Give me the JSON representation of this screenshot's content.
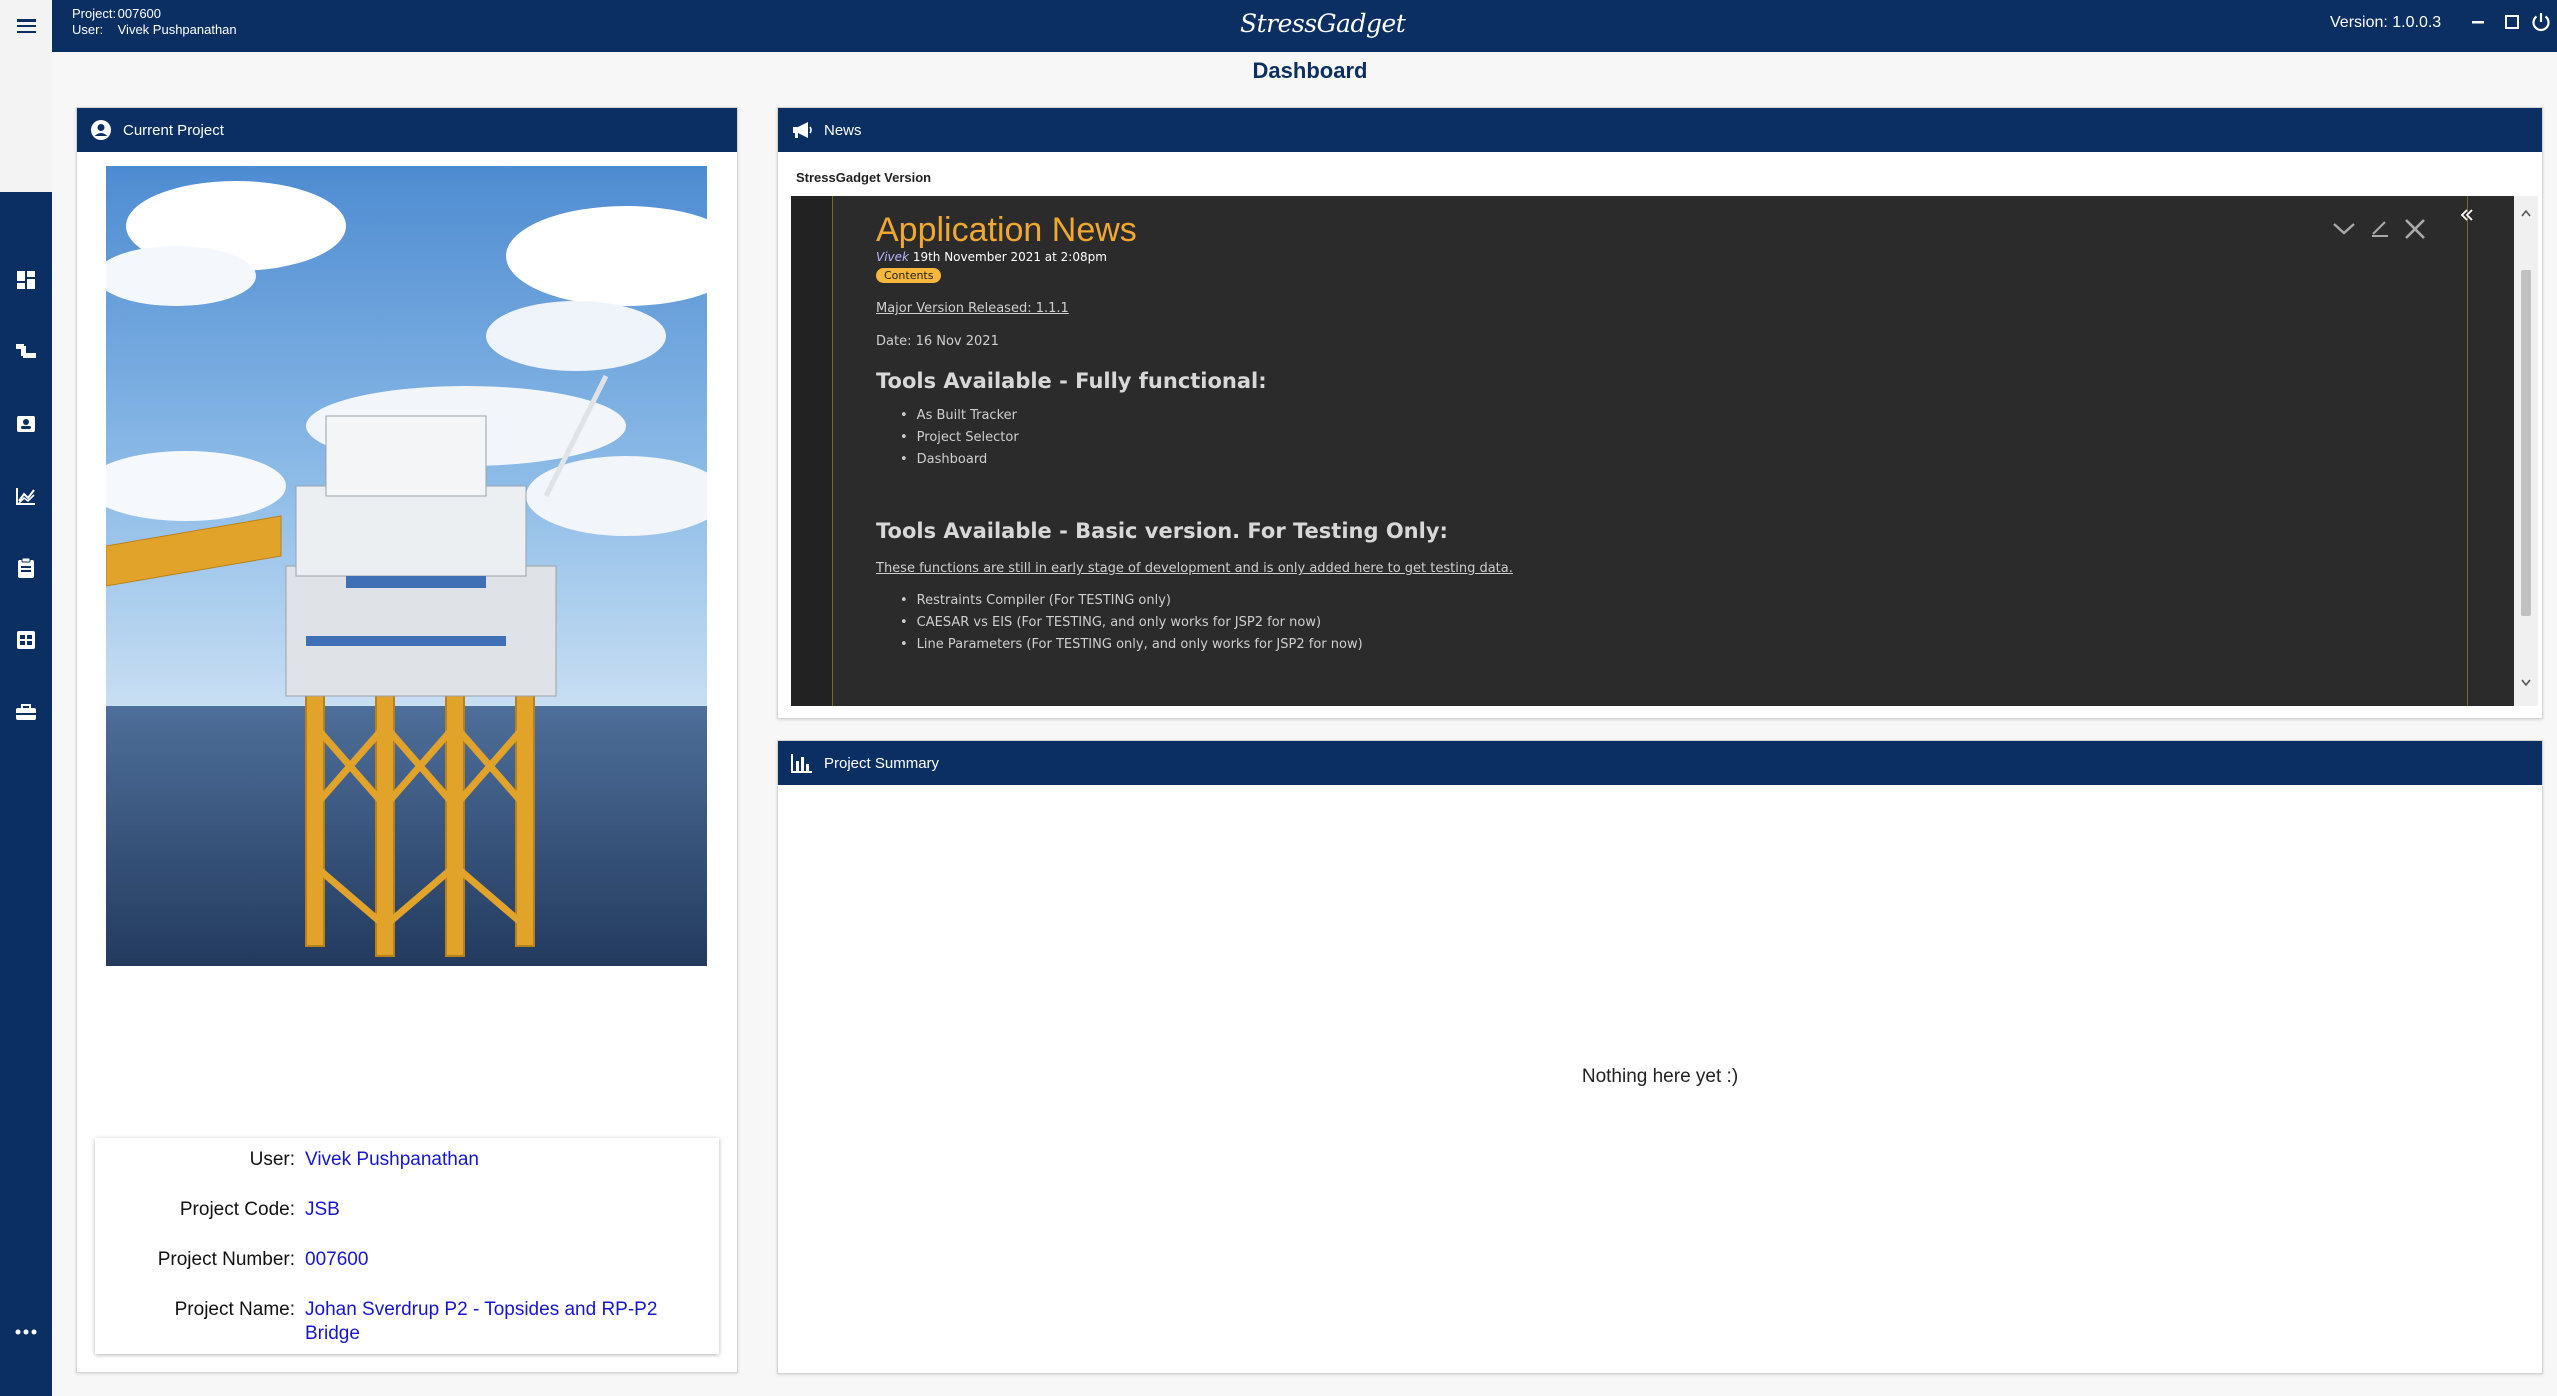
{
  "topbar": {
    "project_label": "Project:",
    "project_value": "007600",
    "user_label": "User:",
    "user_value": "Vivek Pushpanathan",
    "logo_text": "StressGadget",
    "version": "Version: 1.0.0.3"
  },
  "page": {
    "title": "Dashboard"
  },
  "sidebar": {
    "items": [
      {
        "icon": "dashboard-icon"
      },
      {
        "icon": "pipe-route-icon"
      },
      {
        "icon": "contact-card-icon"
      },
      {
        "icon": "line-chart-icon"
      },
      {
        "icon": "clipboard-icon"
      },
      {
        "icon": "table-grid-icon"
      },
      {
        "icon": "toolbox-icon"
      },
      {
        "icon": "more-icon"
      }
    ]
  },
  "current_project": {
    "header": "Current Project",
    "image_alt": "Offshore oil platform",
    "fields": [
      {
        "label": "User:",
        "value": "Vivek Pushpanathan"
      },
      {
        "label": "Project Code:",
        "value": "JSB"
      },
      {
        "label": "Project Number:",
        "value": "007600"
      },
      {
        "label": "Project Name:",
        "value": "Johan Sverdrup P2 - Topsides and RP-P2 Bridge"
      }
    ]
  },
  "news": {
    "header": "News",
    "subtitle": "StressGadget Version",
    "article": {
      "title": "Application News",
      "author": "Vivek",
      "date": "19th November 2021 at 2:08pm",
      "contents_badge": "Contents",
      "release_link": "Major Version Released: 1.1.1",
      "date_line": "Date: 16 Nov 2021",
      "heading1": "Tools Available - Fully functional:",
      "list1": [
        "As Built Tracker",
        "Project Selector",
        "Dashboard"
      ],
      "heading2": "Tools Available - Basic version. For Testing Only:",
      "note": "These functions are still in early stage of development and is only added here to get testing data.",
      "list2": [
        "Restraints Compiler (For TESTING only)",
        "CAESAR vs EIS (For TESTING, and only works for JSP2 for now)",
        "Line Parameters (For TESTING only, and only works for JSP2 for now)"
      ]
    }
  },
  "project_summary": {
    "header": "Project Summary",
    "empty_message": "Nothing here yet :)"
  },
  "colors": {
    "navy": "#0b2f63",
    "news_title": "#f0a830",
    "link_blue": "#1515d0"
  }
}
